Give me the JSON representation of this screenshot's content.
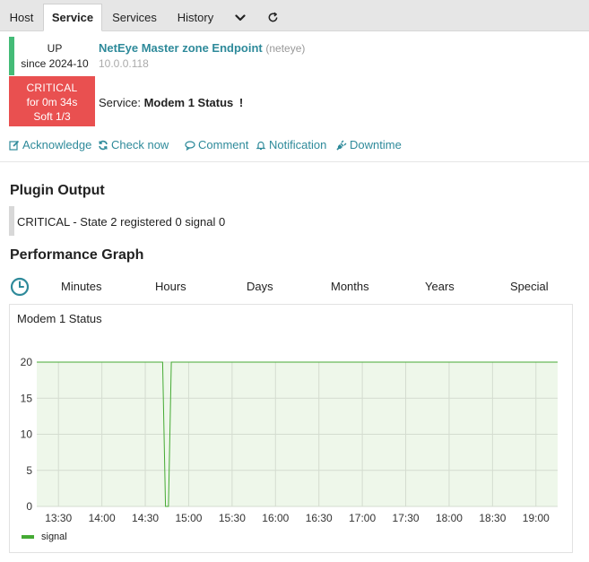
{
  "tabs": {
    "host": "Host",
    "service": "Service",
    "services": "Services",
    "history": "History"
  },
  "host": {
    "state": "UP",
    "since": "since 2024-10",
    "name": "NetEye Master zone Endpoint",
    "alias": "(neteye)",
    "address": "10.0.0.118"
  },
  "service": {
    "state": "CRITICAL",
    "duration": "for 0m 34s",
    "soft": "Soft 1/3",
    "label": "Service:",
    "name": "Modem 1 Status",
    "flag": "!"
  },
  "actions": {
    "acknowledge": "Acknowledge",
    "check_now": "Check now",
    "comment": "Comment",
    "notification": "Notification",
    "downtime": "Downtime"
  },
  "plugin": {
    "heading": "Plugin Output",
    "output": "CRITICAL - State 2 registered 0 signal 0"
  },
  "perf": {
    "heading": "Performance Graph",
    "ranges": [
      "Minutes",
      "Hours",
      "Days",
      "Months",
      "Years",
      "Special"
    ]
  },
  "colors": {
    "accent": "#2e8a9a",
    "up": "#44bb77",
    "critical": "#e95050",
    "series": "#44aa33",
    "plot_bg": "#eef7ea"
  },
  "chart_data": {
    "type": "line",
    "title": "Modem 1 Status",
    "xlabel": "",
    "ylabel": "",
    "x_ticks": [
      "13:30",
      "14:00",
      "14:30",
      "15:00",
      "15:30",
      "16:00",
      "16:30",
      "17:00",
      "17:30",
      "18:00",
      "18:30",
      "19:00"
    ],
    "y_ticks": [
      0,
      5,
      10,
      15,
      20
    ],
    "ylim": [
      0,
      20
    ],
    "xlim": [
      "13:15",
      "19:15"
    ],
    "grid": true,
    "legend": "bottom-left",
    "series": [
      {
        "name": "signal",
        "x": [
          "13:15",
          "14:42",
          "14:44",
          "14:46",
          "14:48",
          "19:15"
        ],
        "y": [
          20,
          20,
          0,
          0,
          20,
          20
        ]
      }
    ]
  }
}
